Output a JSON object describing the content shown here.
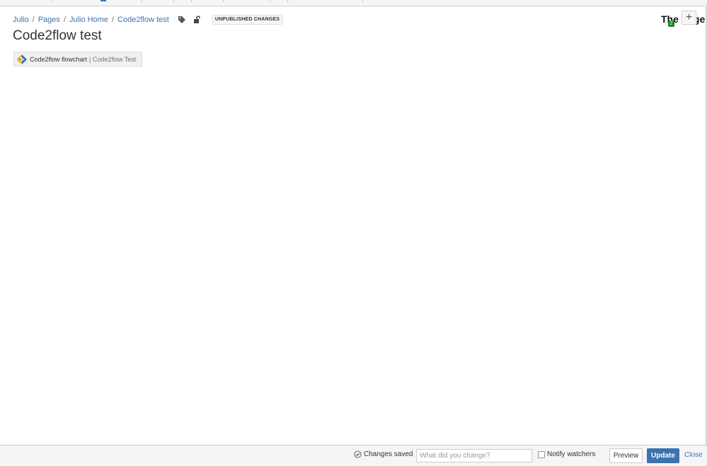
{
  "breadcrumb": {
    "items": [
      "Julio",
      "Pages",
      "Julio Home",
      "Code2flow test"
    ],
    "separator": "/"
  },
  "status": {
    "label": "UNPUBLISHED CHANGES"
  },
  "page": {
    "title": "Code2flow test"
  },
  "macro": {
    "name": "Code2flow flowchart",
    "param": "| Code2flow Test"
  },
  "top_right": {
    "cutoff_text": "The Page",
    "badge_count": "2",
    "plus_label": "+"
  },
  "footer": {
    "saved_text": "Changes saved",
    "comment_placeholder": "What did you change?",
    "notify_label": "Notify watchers",
    "preview_label": "Preview",
    "update_label": "Update",
    "close_label": "Close"
  },
  "icons": [
    "tag-icon",
    "unlock-icon",
    "code2flow-logo-icon",
    "check-circle-icon",
    "plus-icon"
  ],
  "colors": {
    "link": "#3b73af",
    "primary_button": "#3b73af",
    "badge": "#14892c"
  }
}
